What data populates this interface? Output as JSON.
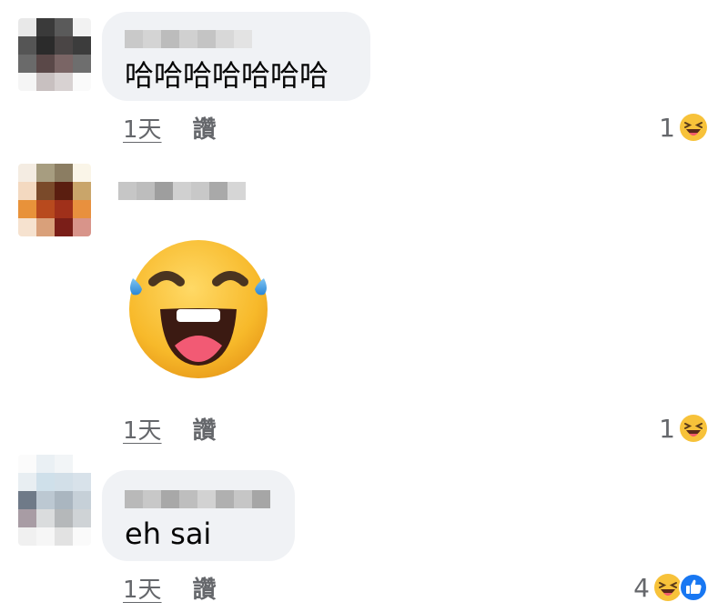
{
  "comments": [
    {
      "text": "哈哈哈哈哈哈哈",
      "time": "1天",
      "like_label": "讚",
      "reaction_count": "1",
      "reactions": [
        "laughing-emoji-icon"
      ]
    },
    {
      "sticker": "laughing-tears-emoji-icon",
      "time": "1天",
      "like_label": "讚",
      "reaction_count": "1",
      "reactions": [
        "laughing-emoji-icon"
      ]
    },
    {
      "text": "eh sai",
      "time": "1天",
      "like_label": "讚",
      "reaction_count": "4",
      "reactions": [
        "laughing-emoji-icon",
        "thumbs-up-icon"
      ]
    }
  ],
  "colors": {
    "bubble": "#f0f2f5",
    "meta_text": "#65676b",
    "like_blue": "#1877f2",
    "emoji_yellow": "#f7c23a"
  }
}
